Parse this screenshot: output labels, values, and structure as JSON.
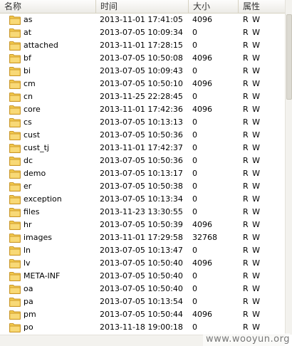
{
  "columns": {
    "name": "名称",
    "time": "时间",
    "size": "大小",
    "attributes": "属性"
  },
  "folder_icon": "folder-icon",
  "colors": {
    "folder": "#f2c94c",
    "folder_dark": "#c9962a",
    "header_bg": "#ecebe6"
  },
  "files": [
    {
      "name": "as",
      "time": "2013-11-01 17:41:05",
      "size": "4096",
      "attr": "R W"
    },
    {
      "name": "at",
      "time": "2013-07-05 10:09:34",
      "size": "0",
      "attr": "R W"
    },
    {
      "name": "attached",
      "time": "2013-11-01 17:28:15",
      "size": "0",
      "attr": "R W"
    },
    {
      "name": "bf",
      "time": "2013-07-05 10:50:08",
      "size": "4096",
      "attr": "R W"
    },
    {
      "name": "bi",
      "time": "2013-07-05 10:09:43",
      "size": "0",
      "attr": "R W"
    },
    {
      "name": "cm",
      "time": "2013-07-05 10:50:10",
      "size": "4096",
      "attr": "R W"
    },
    {
      "name": "cn",
      "time": "2013-11-25 22:28:45",
      "size": "0",
      "attr": "R W"
    },
    {
      "name": "core",
      "time": "2013-11-01 17:42:36",
      "size": "4096",
      "attr": "R W"
    },
    {
      "name": "cs",
      "time": "2013-07-05 10:13:13",
      "size": "0",
      "attr": "R W"
    },
    {
      "name": "cust",
      "time": "2013-07-05 10:50:36",
      "size": "0",
      "attr": "R W"
    },
    {
      "name": "cust_tj",
      "time": "2013-11-01 17:42:37",
      "size": "0",
      "attr": "R W"
    },
    {
      "name": "dc",
      "time": "2013-07-05 10:50:36",
      "size": "0",
      "attr": "R W"
    },
    {
      "name": "demo",
      "time": "2013-07-05 10:13:17",
      "size": "0",
      "attr": "R W"
    },
    {
      "name": "er",
      "time": "2013-07-05 10:50:38",
      "size": "0",
      "attr": "R W"
    },
    {
      "name": "exception",
      "time": "2013-07-05 10:13:34",
      "size": "0",
      "attr": "R W"
    },
    {
      "name": "files",
      "time": "2013-11-23 13:30:55",
      "size": "0",
      "attr": "R W"
    },
    {
      "name": "hr",
      "time": "2013-07-05 10:50:39",
      "size": "4096",
      "attr": "R W"
    },
    {
      "name": "images",
      "time": "2013-11-01 17:29:58",
      "size": "32768",
      "attr": "R W"
    },
    {
      "name": "ln",
      "time": "2013-07-05 10:13:47",
      "size": "0",
      "attr": "R W"
    },
    {
      "name": "lv",
      "time": "2013-07-05 10:50:40",
      "size": "4096",
      "attr": "R W"
    },
    {
      "name": "META-INF",
      "time": "2013-07-05 10:50:40",
      "size": "0",
      "attr": "R W"
    },
    {
      "name": "oa",
      "time": "2013-07-05 10:50:40",
      "size": "0",
      "attr": "R W"
    },
    {
      "name": "pa",
      "time": "2013-07-05 10:13:54",
      "size": "0",
      "attr": "R W"
    },
    {
      "name": "pm",
      "time": "2013-07-05 10:50:44",
      "size": "4096",
      "attr": "R W"
    },
    {
      "name": "po",
      "time": "2013-11-18 19:00:18",
      "size": "0",
      "attr": "R W"
    }
  ],
  "watermark": "www.wooyun.org"
}
